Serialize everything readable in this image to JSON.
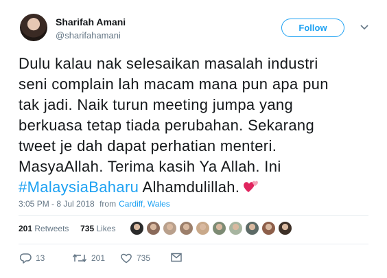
{
  "user": {
    "name": "Sharifah Amani",
    "handle": "@sharifahamani"
  },
  "follow_label": "Follow",
  "tweet": {
    "lines": [
      "Dulu kalau nak selesaikan masalah industri",
      "seni complain lah macam mana pun apa pun",
      "tak jadi. Naik turun meeting jumpa yang",
      "berkuasa tetap tiada perubahan. Sekarang",
      "tweet je dah dapat perhatian menteri.",
      "MasyaAllah. Terima kasih Ya Allah. Ini"
    ],
    "hashtag": "#MalaysiaBaharu",
    "last_text": "Alhamdulillah."
  },
  "meta": {
    "time": "3:05 PM - 8 Jul 2018",
    "from_label": "from",
    "location": "Cardiff, Wales"
  },
  "stats": {
    "retweets_count": "201",
    "retweets_label": "Retweets",
    "likes_count": "735",
    "likes_label": "Likes"
  },
  "faces": [
    {
      "color": "#2b2b2b"
    },
    {
      "color": "#8a6a5a"
    },
    {
      "color": "#b9a08c"
    },
    {
      "color": "#9c7f6b"
    },
    {
      "color": "#c9a98a"
    },
    {
      "color": "#7d8b74"
    },
    {
      "color": "#a7b5a0"
    },
    {
      "color": "#5c6a66"
    },
    {
      "color": "#8d5f4a"
    },
    {
      "color": "#3d3027"
    }
  ],
  "actions": {
    "reply_count": "13",
    "retweet_count": "201",
    "like_count": "735"
  },
  "colors": {
    "accent": "#1da1f2",
    "text": "#14171a",
    "secondary": "#657786",
    "heart_emoji": "#e0245e"
  },
  "icons": [
    "chevron-down-icon",
    "reply-icon",
    "retweet-icon",
    "like-icon",
    "dm-icon",
    "two-hearts-emoji"
  ]
}
